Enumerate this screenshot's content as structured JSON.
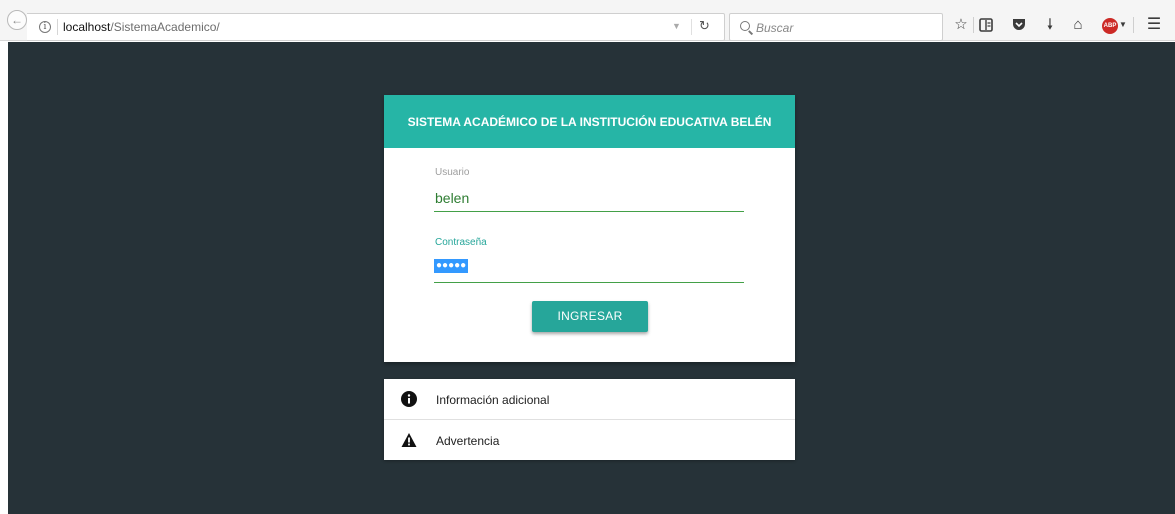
{
  "browser": {
    "url_host": "localhost",
    "url_path": "/SistemaAcademico/",
    "search_placeholder": "Buscar",
    "toolbar_icons": [
      "star-icon",
      "reading-list-icon",
      "pocket-icon",
      "download-icon",
      "home-icon",
      "adblock-icon",
      "menu-icon"
    ],
    "adblock_label": "ABP"
  },
  "login": {
    "title": "SISTEMA ACADÉMICO DE LA INSTITUCIÓN EDUCATIVA BELÉN",
    "username_label": "Usuario",
    "username_value": "belen",
    "password_label": "Contraseña",
    "password_mask": "●●●●●",
    "submit_label": "INGRESAR",
    "header_color": "#26b5a6",
    "button_color": "#26a69a"
  },
  "info_list": {
    "items": [
      {
        "label": "Información adicional",
        "icon": "info-circle-icon"
      },
      {
        "label": "Advertencia",
        "icon": "warning-triangle-icon"
      }
    ]
  },
  "colors": {
    "page_background": "#263238",
    "input_underline": "#43a047"
  }
}
